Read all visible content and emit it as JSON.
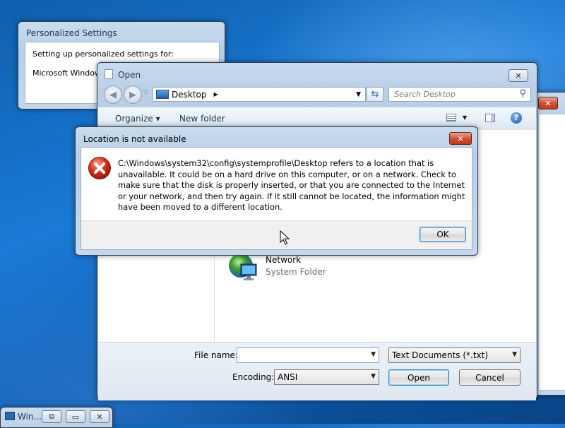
{
  "personalized": {
    "title": "Personalized Settings",
    "line1": "Setting up personalized settings for:",
    "line2": "Microsoft Windows"
  },
  "open_dialog": {
    "title": "Open",
    "address": "Desktop",
    "search_placeholder": "Search Desktop",
    "toolbar": {
      "organize": "Organize ▾",
      "new_folder": "New folder"
    },
    "item": {
      "name": "Network",
      "type": "System Folder"
    },
    "file_name_label": "File name:",
    "file_name_value": "",
    "file_type": "Text Documents (*.txt)",
    "encoding_label": "Encoding:",
    "encoding_value": "ANSI",
    "open_button": "Open",
    "cancel_button": "Cancel"
  },
  "error_dialog": {
    "title": "Location is not available",
    "message": "C:\\Windows\\system32\\config\\systemprofile\\Desktop refers to a location that is unavailable. It could be on a hard drive on this computer, or on a network. Check to make sure that the disk is properly inserted, or that you are connected to the Internet or your network, and then try again. If it still cannot be located, the information might have been moved to a different location.",
    "ok_button": "OK"
  },
  "taskbar": {
    "label": "Win..."
  },
  "colors": {
    "accent": "#1e395b",
    "error_red": "#c1271a",
    "desktop_blue": "#1a7ad6"
  }
}
